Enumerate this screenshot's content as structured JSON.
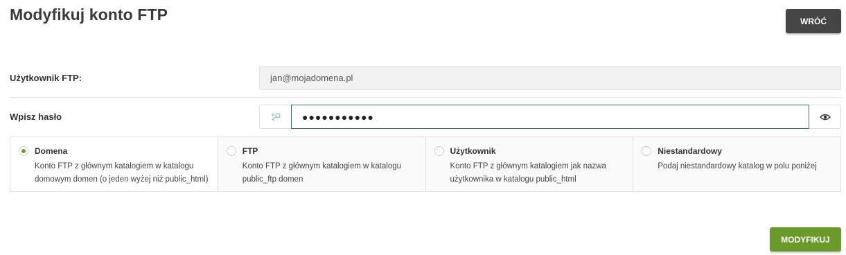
{
  "page": {
    "title": "Modyfikuj konto FTP"
  },
  "header": {
    "back_label": "WRÓĆ"
  },
  "form": {
    "user": {
      "label": "Użytkownik FTP:",
      "value": "jan@mojadomena.pl"
    },
    "password": {
      "label": "Wpisz hasło",
      "value": "●●●●●●●●●●●",
      "generate_icon": "key-generate-icon",
      "reveal_icon": "eye-icon"
    }
  },
  "directory_options": [
    {
      "title": "Domena",
      "desc": "Konto FTP z głównym katalogiem w katalogu domowym domen (o jeden wyżej niż public_html)",
      "selected": true
    },
    {
      "title": "FTP",
      "desc": "Konto FTP z głównym katalogiem w katalogu public_ftp domen",
      "selected": false
    },
    {
      "title": "Użytkownik",
      "desc": "Konto FTP z głównym katalogiem jak nazwa użytkownika w katalogu public_html",
      "selected": false
    },
    {
      "title": "Niestandardowy",
      "desc": "Podaj niestandardowy katalog w polu poniżej",
      "selected": false
    }
  ],
  "footer": {
    "submit_label": "MODYFIKUJ"
  },
  "colors": {
    "accent_green": "#6a9a2a",
    "back_button": "#454545",
    "focus_border": "#2f6b86"
  }
}
